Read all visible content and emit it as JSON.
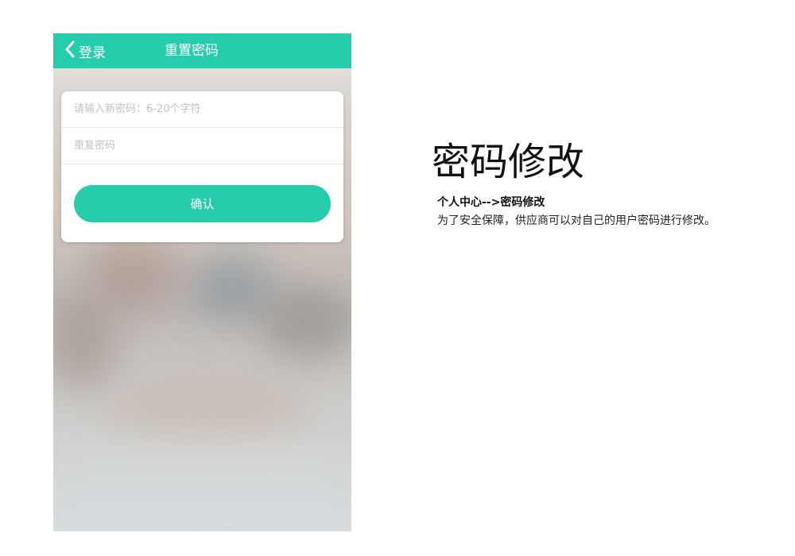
{
  "phone": {
    "header": {
      "back_label": "登录",
      "title": "重置密码"
    },
    "form": {
      "new_password_placeholder": "请输入新密码：6-20个字符",
      "repeat_password_placeholder": "重复密码",
      "confirm_label": "确认"
    }
  },
  "info": {
    "heading": "密码修改",
    "path": "个人中心-->密码修改",
    "description": "为了安全保障，供应商可以对自己的用户密码进行修改。"
  },
  "colors": {
    "accent": "#25cdad",
    "background": "#ffffff"
  },
  "icons": {
    "back": "chevron-left-icon"
  }
}
